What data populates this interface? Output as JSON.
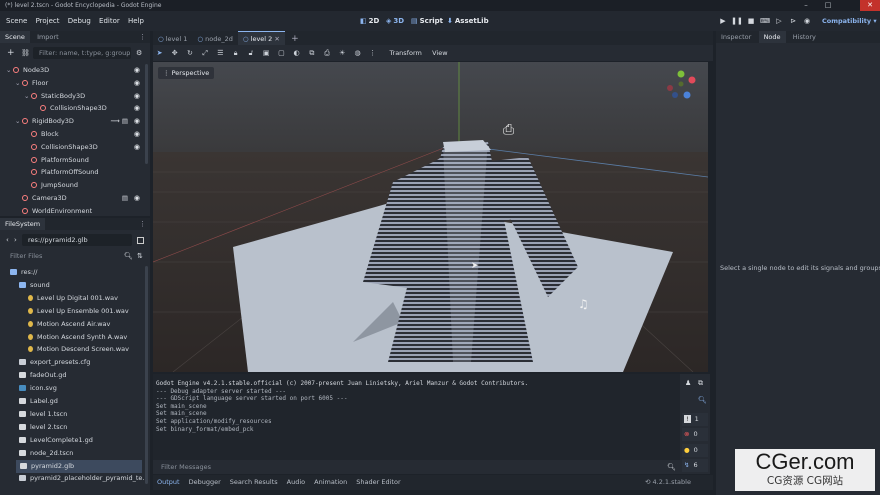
{
  "window": {
    "title": "(*) level 2.tscn - Godot Encyclopedia - Godot Engine",
    "controls": [
      "–",
      "□",
      "✕"
    ]
  },
  "menu": [
    "Scene",
    "Project",
    "Debug",
    "Editor",
    "Help"
  ],
  "workspaces": {
    "w2d": "2D",
    "w3d": "3D",
    "script": "Script",
    "assetlib": "AssetLib",
    "renderer": "Compatibility ▾"
  },
  "scene_dock": {
    "tabs": [
      "Scene",
      "Import"
    ],
    "filter_placeholder": "Filter: name, t:type, g:group",
    "tree": [
      {
        "label": "Node3D",
        "color": "#fc7f7f",
        "indent": 0,
        "arrow": "⌄",
        "eye": true,
        "extra": ""
      },
      {
        "label": "Floor",
        "color": "#fc7f7f",
        "indent": 1,
        "arrow": "⌄",
        "eye": true,
        "extra": ""
      },
      {
        "label": "StaticBody3D",
        "color": "#fc7f7f",
        "indent": 2,
        "arrow": "⌄",
        "eye": true,
        "extra": ""
      },
      {
        "label": "CollisionShape3D",
        "color": "#fc7f7f",
        "indent": 3,
        "arrow": "",
        "eye": true,
        "extra": ""
      },
      {
        "label": "RigidBody3D",
        "color": "#fc7f7f",
        "indent": 1,
        "arrow": "⌄",
        "eye": true,
        "extra": "signal script"
      },
      {
        "label": "Block",
        "color": "#fc7f7f",
        "indent": 2,
        "arrow": "",
        "eye": true,
        "extra": ""
      },
      {
        "label": "CollisionShape3D",
        "color": "#fc7f7f",
        "indent": 2,
        "arrow": "",
        "eye": true,
        "extra": ""
      },
      {
        "label": "PlatformSound",
        "color": "#fc7f7f",
        "indent": 2,
        "arrow": "",
        "eye": false,
        "extra": ""
      },
      {
        "label": "PlatformOffSound",
        "color": "#fc7f7f",
        "indent": 2,
        "arrow": "",
        "eye": false,
        "extra": ""
      },
      {
        "label": "JumpSound",
        "color": "#fc7f7f",
        "indent": 2,
        "arrow": "",
        "eye": false,
        "extra": ""
      },
      {
        "label": "Camera3D",
        "color": "#fc7f7f",
        "indent": 1,
        "arrow": "",
        "eye": true,
        "extra": "script"
      },
      {
        "label": "WorldEnvironment",
        "color": "#fc7f7f",
        "indent": 1,
        "arrow": "",
        "eye": false,
        "extra": ""
      }
    ]
  },
  "filesystem": {
    "tab": "FileSystem",
    "path": "res://pyramid2.glb",
    "filter_placeholder": "Filter Files",
    "items": [
      {
        "label": "res://",
        "kind": "folder",
        "indent": 0,
        "selected": false
      },
      {
        "label": "sound",
        "kind": "folder",
        "indent": 1,
        "selected": false
      },
      {
        "label": "Level Up Digital 001.wav",
        "kind": "audio",
        "indent": 2,
        "selected": false
      },
      {
        "label": "Level Up Ensemble 001.wav",
        "kind": "audio",
        "indent": 2,
        "selected": false
      },
      {
        "label": "Motion Ascend Air.wav",
        "kind": "audio",
        "indent": 2,
        "selected": false
      },
      {
        "label": "Motion Ascend Synth A.wav",
        "kind": "audio",
        "indent": 2,
        "selected": false
      },
      {
        "label": "Motion Descend Screen.wav",
        "kind": "audio",
        "indent": 2,
        "selected": false
      },
      {
        "label": "export_presets.cfg",
        "kind": "cfg",
        "indent": 1,
        "selected": false
      },
      {
        "label": "fadeOut.gd",
        "kind": "gd",
        "indent": 1,
        "selected": false
      },
      {
        "label": "icon.svg",
        "kind": "svg",
        "indent": 1,
        "selected": false
      },
      {
        "label": "Label.gd",
        "kind": "gd",
        "indent": 1,
        "selected": false
      },
      {
        "label": "level 1.tscn",
        "kind": "scene",
        "indent": 1,
        "selected": false
      },
      {
        "label": "level 2.tscn",
        "kind": "scene",
        "indent": 1,
        "selected": false
      },
      {
        "label": "LevelComplete1.gd",
        "kind": "gd",
        "indent": 1,
        "selected": false
      },
      {
        "label": "node_2d.tscn",
        "kind": "scene",
        "indent": 1,
        "selected": false
      },
      {
        "label": "pyramid2.glb",
        "kind": "glb",
        "indent": 1,
        "selected": true
      },
      {
        "label": "pyramid2_placeholder_pyramid_te...",
        "kind": "img",
        "indent": 1,
        "selected": false
      }
    ]
  },
  "editor_tabs": [
    {
      "label": "level 1",
      "active": false
    },
    {
      "label": "node_2d",
      "active": false
    },
    {
      "label": "level 2",
      "active": true
    }
  ],
  "viewport_toolbar": {
    "transform": "Transform",
    "view": "View"
  },
  "viewport": {
    "perspective": "Perspective"
  },
  "output": {
    "lines": [
      "Godot Engine v4.2.1.stable.official (c) 2007-present Juan Linietsky, Ariel Manzur & Godot Contributors.",
      "--- Debug adapter server started ---",
      "--- GDScript language server started on port 6005 ---",
      "Set main_scene",
      "Set main_scene",
      "Set application/modify_resources",
      "Set binary_format/embed_pck"
    ],
    "filter_placeholder": "Filter Messages",
    "counts": {
      "messages": "1",
      "errors": "0",
      "warnings": "0",
      "editor": "6"
    }
  },
  "bottom_tabs": [
    "Output",
    "Debugger",
    "Search Results",
    "Audio",
    "Animation",
    "Shader Editor"
  ],
  "version": "4.2.1.stable",
  "inspector": {
    "tabs": [
      "Inspector",
      "Node",
      "History"
    ],
    "message": "Select a single node to edit its signals and groups."
  },
  "watermark": {
    "main": "CGer.com",
    "sub": "CG资源 CG网站"
  }
}
